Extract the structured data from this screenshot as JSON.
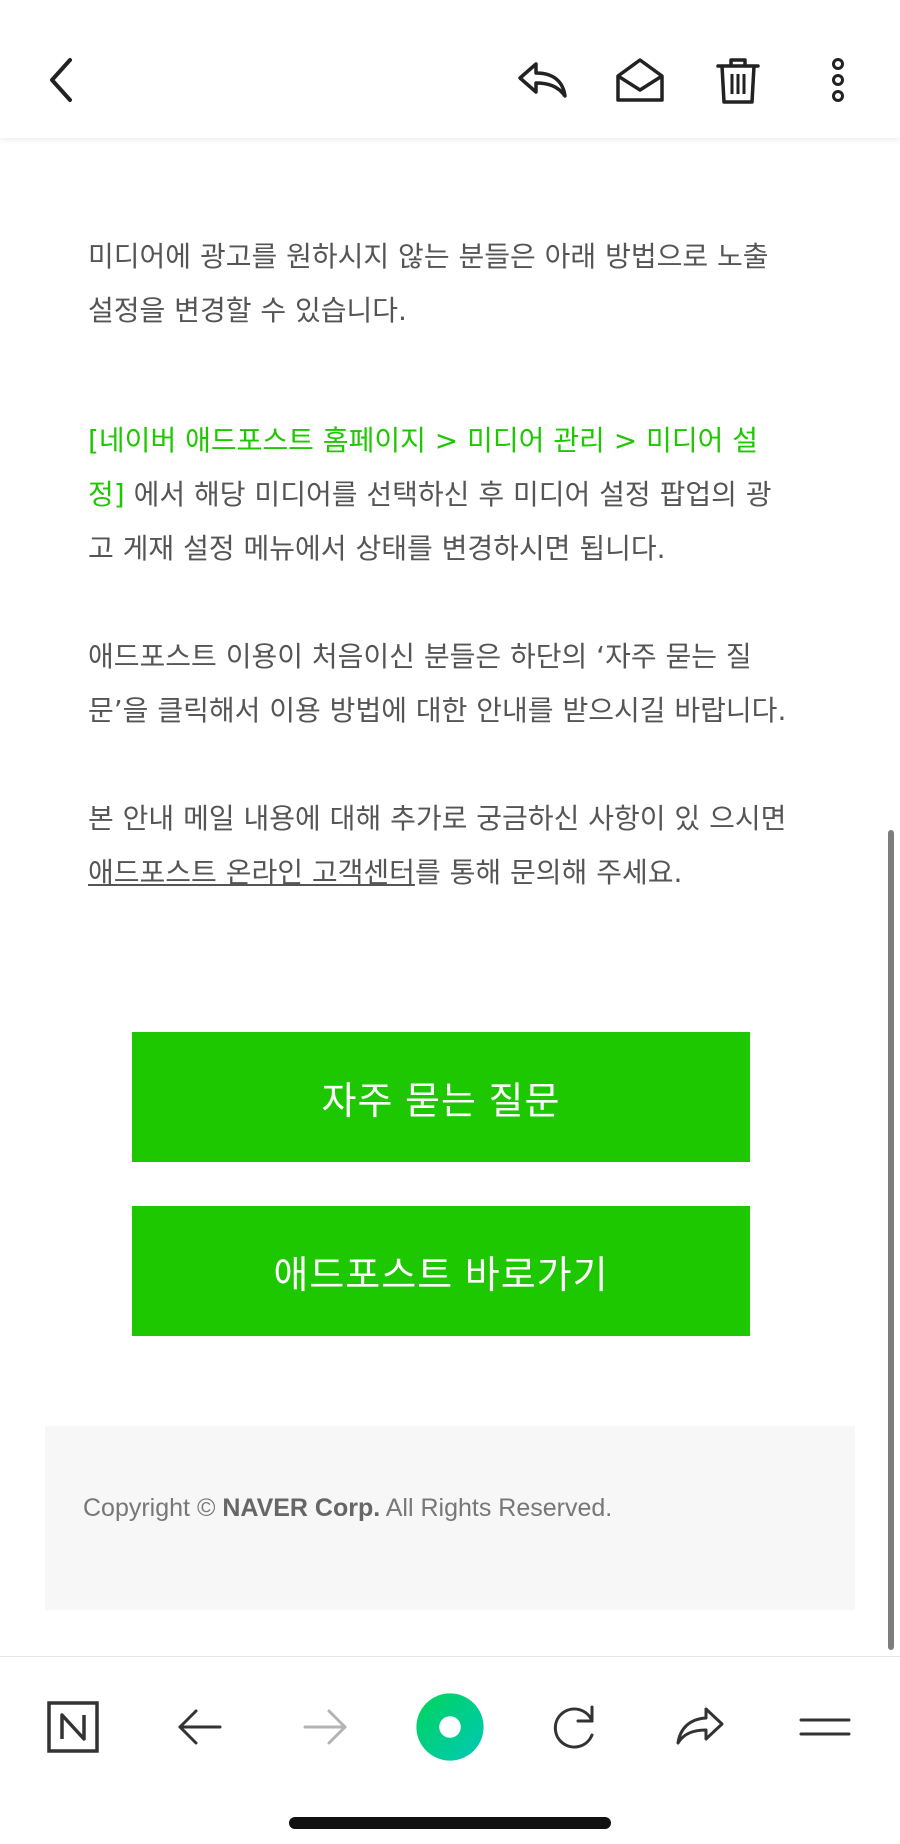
{
  "toolbar": {
    "back_icon": "chevron-left-icon",
    "reply_icon": "reply-icon",
    "mark_read_icon": "envelope-open-icon",
    "delete_icon": "trash-icon",
    "more_icon": "more-vertical-icon"
  },
  "body": {
    "p1": "미디어에 광고를 원하시지 않는 분들은 아래 방법으로 노출 설정을 변경할 수 있습니다.",
    "p2_link": "[네이버 애드포스트 홈페이지 > 미디어 관리 > 미디어 설정]",
    "p2_rest": "에서 해당 미디어를 선택하신 후 미디어 설정 팝업의 광고 게재 설정 메뉴에서 상태를 변경하시면 됩니다.",
    "p3": "애드포스트 이용이 처음이신 분들은 하단의 ‘자주 묻는 질문’을 클릭해서 이용 방법에 대한 안내를 받으시길 바랍니다.",
    "p4_prefix": "본 안내 메일 내용에 대해 추가로 궁금하신 사항이 있 으시면 ",
    "p4_link": "애드포스트 온라인 고객센터",
    "p4_suffix": "를 통해 문의해 주세요."
  },
  "buttons": {
    "faq": "자주 묻는 질문",
    "adpost": "애드포스트 바로가기"
  },
  "footer": {
    "copyright_prefix": "Copyright © ",
    "company": "NAVER Corp.",
    "copyright_suffix": " All Rights Reserved."
  },
  "browser_nav": {
    "home_icon": "naver-n-icon",
    "back_icon": "arrow-left-icon",
    "forward_icon": "arrow-right-icon",
    "green_dot_icon": "green-dot-icon",
    "refresh_icon": "refresh-icon",
    "share_icon": "share-icon",
    "menu_icon": "menu-icon"
  },
  "colors": {
    "accent": "#1ec800",
    "text": "#555555"
  }
}
